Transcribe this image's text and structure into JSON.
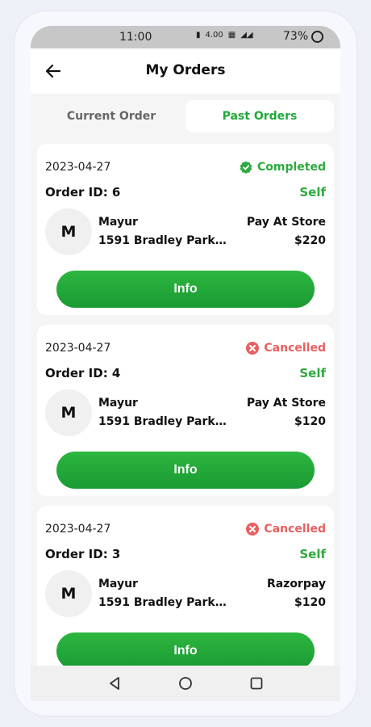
{
  "statusbar": {
    "time": "11:00",
    "speed": "4.00",
    "battery": "73%"
  },
  "appbar": {
    "title": "My Orders"
  },
  "tabs": [
    {
      "label": "Current Order",
      "active": false
    },
    {
      "label": "Past Orders",
      "active": true
    }
  ],
  "orders": [
    {
      "date": "2023-04-27",
      "status": "Completed",
      "order_id": "Order ID: 6",
      "type": "Self",
      "avatar": "M",
      "name": "Mayur",
      "address": "1591 Bradley Park Dr,...",
      "payment": "Pay At Store",
      "price": "$220",
      "button": "Info"
    },
    {
      "date": "2023-04-27",
      "status": "Cancelled",
      "order_id": "Order ID: 4",
      "type": "Self",
      "avatar": "M",
      "name": "Mayur",
      "address": "1591 Bradley Park Dr,...",
      "payment": "Pay At Store",
      "price": "$120",
      "button": "Info"
    },
    {
      "date": "2023-04-27",
      "status": "Cancelled",
      "order_id": "Order ID: 3",
      "type": "Self",
      "avatar": "M",
      "name": "Mayur",
      "address": "1591 Bradley Park Dr,...",
      "payment": "Razorpay",
      "price": "$120",
      "button": "Info"
    }
  ],
  "colors": {
    "accent": "#2eaa3f",
    "cancelled": "#e86060",
    "button": "#1faa3a"
  }
}
